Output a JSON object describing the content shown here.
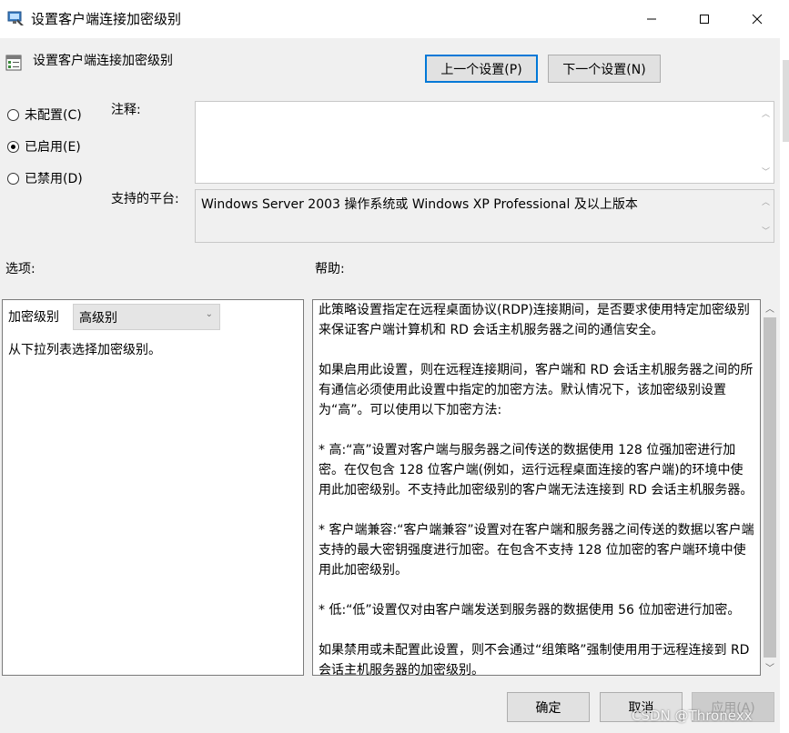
{
  "window": {
    "title": "设置客户端连接加密级别",
    "buttons": [
      "minimize",
      "maximize",
      "close"
    ]
  },
  "header": {
    "policy_name": "设置客户端连接加密级别",
    "prev_label": "上一个设置(P)",
    "next_label": "下一个设置(N)"
  },
  "state": {
    "options": [
      {
        "label": "未配置(C)",
        "checked": false
      },
      {
        "label": "已启用(E)",
        "checked": true
      },
      {
        "label": "已禁用(D)",
        "checked": false
      }
    ]
  },
  "comment": {
    "label": "注释:",
    "value": ""
  },
  "platform": {
    "label": "支持的平台:",
    "value": "Windows Server 2003 操作系统或 Windows XP Professional 及以上版本"
  },
  "options_section": {
    "label": "选项:",
    "level_label": "加密级别",
    "level_value": "高级别",
    "hint": "从下拉列表选择加密级别。"
  },
  "help_section": {
    "label": "帮助:",
    "paragraphs": [
      "此策略设置指定在远程桌面协议(RDP)连接期间，是否要求使用特定加密级别来保证客户端计算机和 RD 会话主机服务器之间的通信安全。",
      "如果启用此设置，则在远程连接期间，客户端和 RD 会话主机服务器之间的所有通信必须使用此设置中指定的加密方法。默认情况下，该加密级别设置为“高”。可以使用以下加密方法:",
      "* 高:“高”设置对客户端与服务器之间传送的数据使用 128 位强加密进行加密。在仅包含 128 位客户端(例如，运行远程桌面连接的客户端)的环境中使用此加密级别。不支持此加密级别的客户端无法连接到 RD 会话主机服务器。",
      "* 客户端兼容:“客户端兼容”设置对在客户端和服务器之间传送的数据以客户端支持的最大密钥强度进行加密。在包含不支持 128 位加密的客户端环境中使用此加密级别。",
      "* 低:“低”设置仅对由客户端发送到服务器的数据使用 56 位加密进行加密。",
      "如果禁用或未配置此设置，则不会通过“组策略”强制使用用于远程连接到 RD 会话主机服务器的加密级别。"
    ]
  },
  "footer": {
    "ok_label": "确定",
    "cancel_label": "取消",
    "apply_label": "应用(A)"
  },
  "watermark": "CSDN @Thronexx"
}
